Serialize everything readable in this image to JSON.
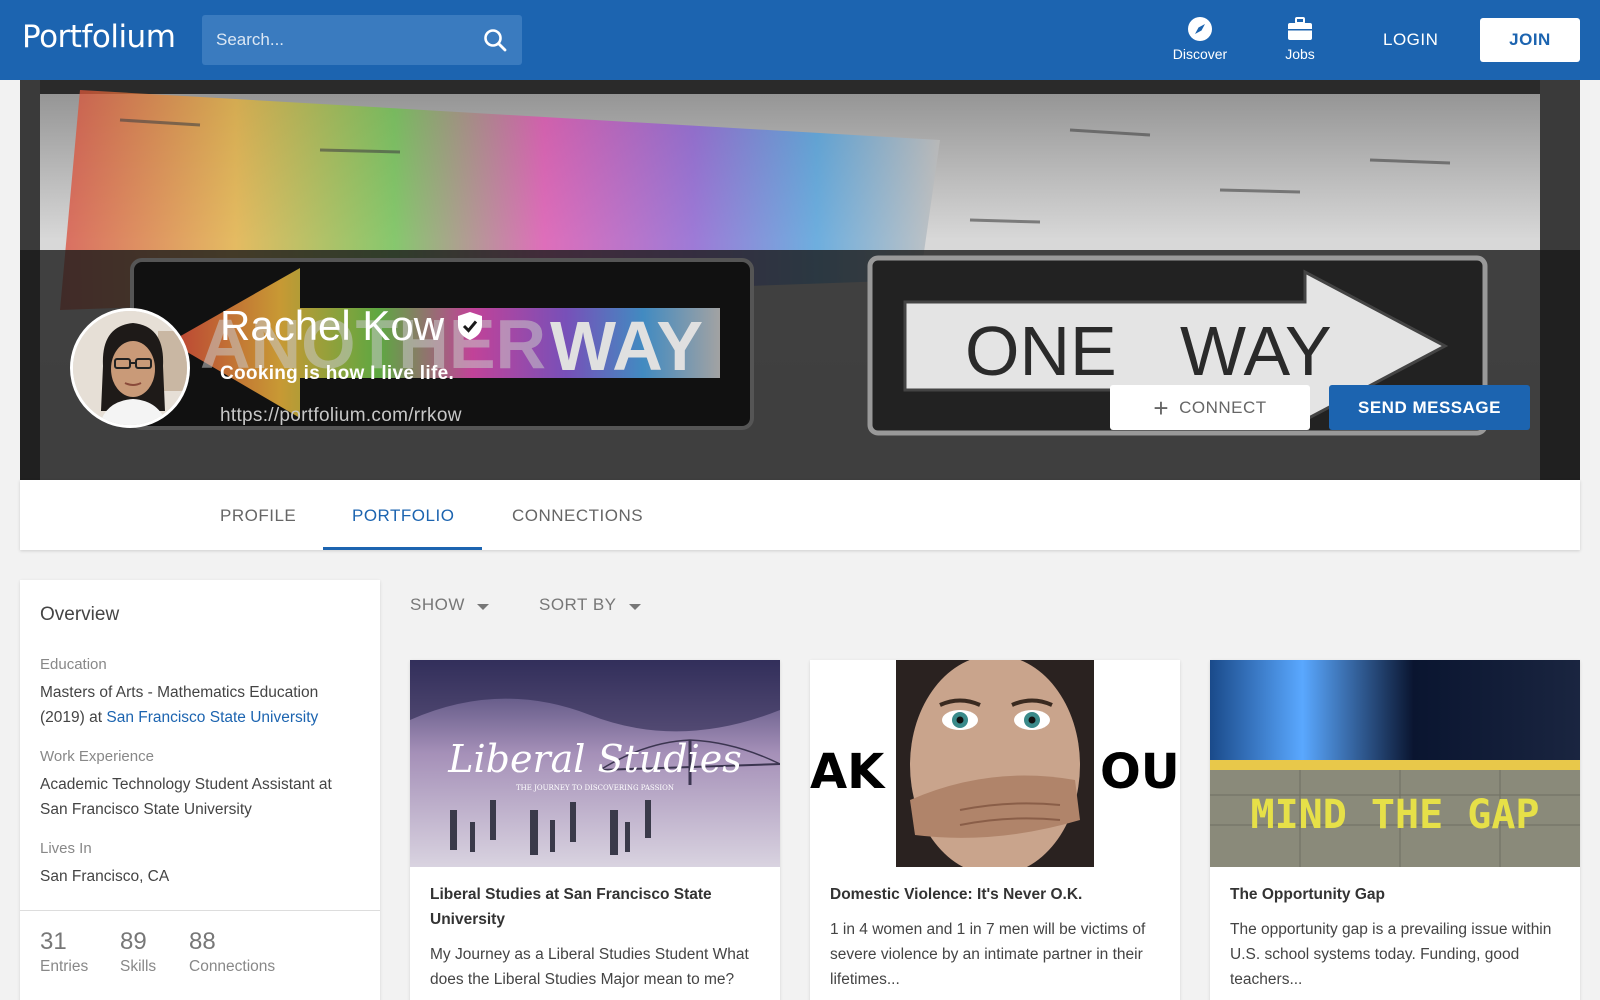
{
  "header": {
    "logo": "Portfolium",
    "search_placeholder": "Search...",
    "nav": [
      {
        "label": "Discover",
        "icon": "compass-icon"
      },
      {
        "label": "Jobs",
        "icon": "briefcase-icon"
      }
    ],
    "login_label": "LOGIN",
    "join_label": "JOIN"
  },
  "profile": {
    "name": "Rachel Kow",
    "verified": true,
    "tagline": "Cooking is how I live life.",
    "url": "https://portfolium.com/rrkow",
    "connect_label": "CONNECT",
    "message_label": "SEND MESSAGE",
    "banner_signs": [
      "ANOTHER WAY",
      "ONE WAY"
    ]
  },
  "tabs": [
    {
      "label": "PROFILE",
      "active": false
    },
    {
      "label": "PORTFOLIO",
      "active": true
    },
    {
      "label": "CONNECTIONS",
      "active": false
    }
  ],
  "overview": {
    "title": "Overview",
    "education_label": "Education",
    "education_text": "Masters of Arts - Mathematics Education (2019) at",
    "education_school": "San Francisco State University",
    "work_label": "Work Experience",
    "work_text": "Academic Technology Student Assistant at San Francisco State University",
    "lives_label": "Lives In",
    "lives_text": "San Francisco, CA",
    "stats": [
      {
        "value": "31",
        "label": "Entries"
      },
      {
        "value": "89",
        "label": "Skills"
      },
      {
        "value": "88",
        "label": "Connections"
      }
    ]
  },
  "filters": {
    "show_label": "SHOW",
    "sort_label": "SORT BY"
  },
  "cards": [
    {
      "title": "Liberal Studies at San Francisco State University",
      "description": "My Journey as a Liberal Studies Student What does the Liberal Studies Major mean to me?",
      "image_title": "Liberal Studies",
      "image_subtitle": "THE JOURNEY TO DISCOVERING PASSION"
    },
    {
      "title": "Domestic Violence: It's Never O.K.",
      "description": "1 in 4 women and 1 in 7 men will be victims of severe violence by an intimate partner in their lifetimes...",
      "image_left_text": "AK",
      "image_right_text": "OU"
    },
    {
      "title": "The Opportunity Gap",
      "description": "The opportunity gap is a prevailing issue within U.S. school systems today. Funding, good teachers...",
      "image_text": "MIND THE GAP"
    }
  ],
  "colors": {
    "brand": "#1c64b0",
    "background": "#f2f2f2"
  }
}
